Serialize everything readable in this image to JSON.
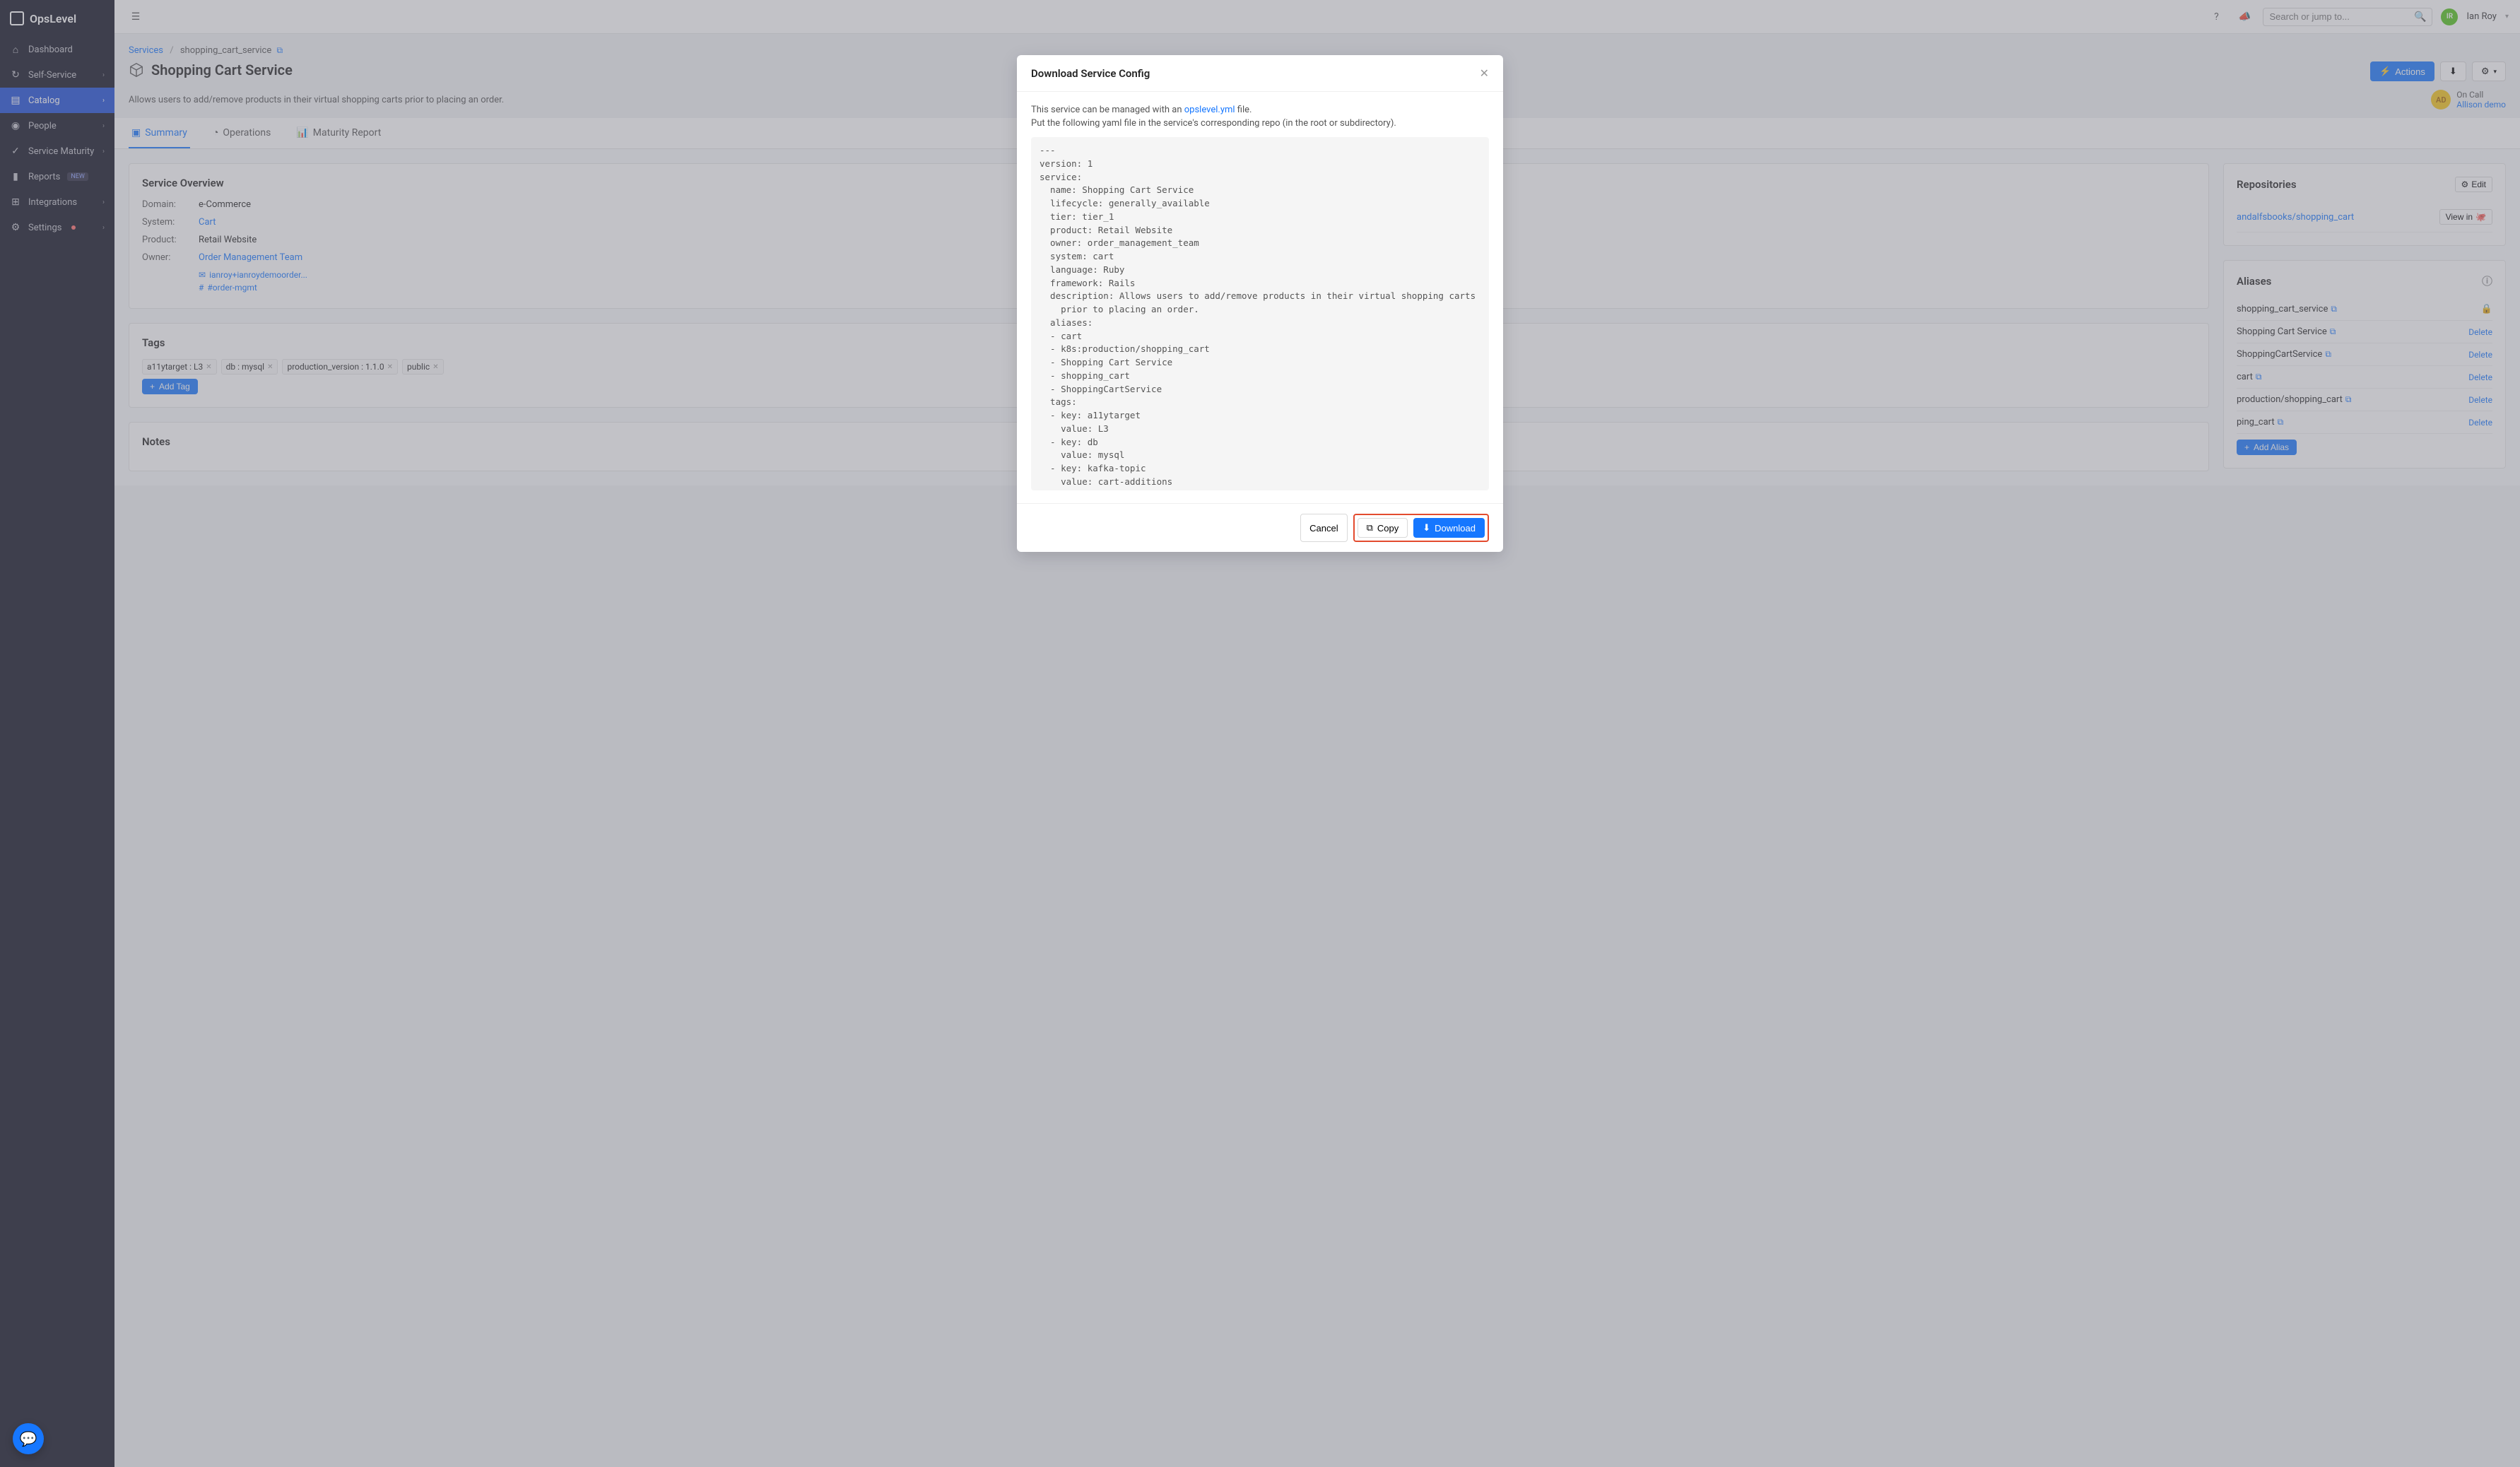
{
  "brand": "OpsLevel",
  "nav": {
    "dashboard": "Dashboard",
    "self_service": "Self-Service",
    "catalog": "Catalog",
    "people": "People",
    "maturity": "Service Maturity",
    "reports": "Reports",
    "reports_badge": "NEW",
    "integrations": "Integrations",
    "settings": "Settings"
  },
  "topbar": {
    "search_placeholder": "Search or jump to...",
    "user_initials": "IR",
    "user_name": "Ian Roy"
  },
  "breadcrumbs": {
    "services": "Services",
    "current": "shopping_cart_service"
  },
  "page": {
    "title": "Shopping Cart Service",
    "description": "Allows users to add/remove products in their virtual shopping carts prior to placing an order.",
    "actions_label": "Actions",
    "oncall_label": "On Call",
    "oncall_name": "Allison demo",
    "oncall_initials": "AD"
  },
  "tabs": {
    "summary": "Summary",
    "operations": "Operations",
    "maturity": "Maturity Report"
  },
  "overview": {
    "title": "Service Overview",
    "domain_label": "Domain:",
    "domain_value": "e-Commerce",
    "system_label": "System:",
    "system_value": "Cart",
    "product_label": "Product:",
    "product_value": "Retail Website",
    "owner_label": "Owner:",
    "owner_value": "Order Management Team",
    "owner_email": "ianroy+ianroydemoorder...",
    "owner_slack": "#order-mgmt"
  },
  "tags_card": {
    "title": "Tags",
    "add_label": "Add Tag",
    "tags": [
      "a11ytarget : L3",
      "db : mysql",
      "production_version : 1.1.0",
      "public"
    ]
  },
  "notes_card": {
    "title": "Notes"
  },
  "repos": {
    "title": "Repositories",
    "edit_label": "Edit",
    "repo_name": "andalfsbooks/shopping_cart",
    "view_in": "View in"
  },
  "aliases": {
    "title": "Aliases",
    "add_label": "Add Alias",
    "delete_label": "Delete",
    "items": [
      {
        "name": "shopping_cart_service",
        "locked": true
      },
      {
        "name": "Shopping Cart Service",
        "locked": false
      },
      {
        "name": "ShoppingCartService",
        "locked": false
      },
      {
        "name": "cart",
        "locked": false,
        "truncated": true
      },
      {
        "name": "k8s:production/shopping_cart",
        "locked": false,
        "truncated_name": "production/shopping_cart"
      },
      {
        "name": "shopping_cart",
        "locked": false,
        "truncated_name": "ping_cart"
      }
    ]
  },
  "modal": {
    "title": "Download Service Config",
    "intro1": "This service can be managed with an ",
    "intro1_link": "opslevel.yml",
    "intro1_suffix": " file.",
    "intro2": "Put the following yaml file in the service's corresponding repo (in the root or subdirectory).",
    "yaml": "---\nversion: 1\nservice:\n  name: Shopping Cart Service\n  lifecycle: generally_available\n  tier: tier_1\n  product: Retail Website\n  owner: order_management_team\n  system: cart\n  language: Ruby\n  framework: Rails\n  description: Allows users to add/remove products in their virtual shopping carts\n    prior to placing an order.\n  aliases:\n  - cart\n  - k8s:production/shopping_cart\n  - Shopping Cart Service\n  - shopping_cart\n  - ShoppingCartService\n  tags:\n  - key: a11ytarget\n    value: L3\n  - key: db\n    value: mysql\n  - key: kafka-topic\n    value: cart-additions\n  - key: pd_id\n    value: PHHMSFU\n  - key: product\n    value: retail website",
    "cancel": "Cancel",
    "copy": "Copy",
    "download": "Download"
  }
}
